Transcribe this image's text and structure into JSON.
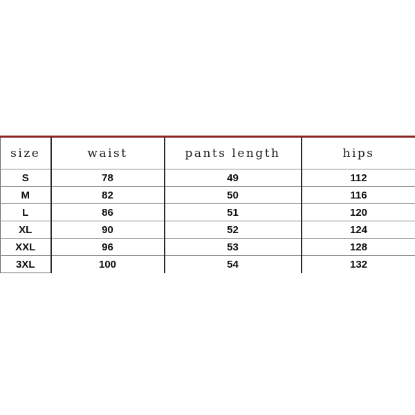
{
  "chart_data": {
    "type": "table",
    "title": "",
    "columns": [
      "size",
      "waist",
      "pants length",
      "hips"
    ],
    "rows": [
      [
        "S",
        "78",
        "49",
        "112"
      ],
      [
        "M",
        "82",
        "50",
        "116"
      ],
      [
        "L",
        "86",
        "51",
        "120"
      ],
      [
        "XL",
        "90",
        "52",
        "124"
      ],
      [
        "XXL",
        "96",
        "53",
        "128"
      ],
      [
        "3XL",
        "100",
        "54",
        "132"
      ]
    ],
    "units": "",
    "legend": "",
    "grid": true
  },
  "table": {
    "headers": {
      "size": "size",
      "waist": "waist",
      "pants_length": "pants length",
      "hips": "hips"
    },
    "rows": [
      {
        "size": "S",
        "waist": "78",
        "pants_length": "49",
        "hips": "112"
      },
      {
        "size": "M",
        "waist": "82",
        "pants_length": "50",
        "hips": "116"
      },
      {
        "size": "L",
        "waist": "86",
        "pants_length": "51",
        "hips": "120"
      },
      {
        "size": "XL",
        "waist": "90",
        "pants_length": "52",
        "hips": "124"
      },
      {
        "size": "XXL",
        "waist": "96",
        "pants_length": "53",
        "hips": "128"
      },
      {
        "size": "3XL",
        "waist": "100",
        "pants_length": "54",
        "hips": "132"
      }
    ]
  },
  "colors": {
    "page_background": "#ffffff",
    "top_rule": "#8b2525",
    "column_divider": "#2b2b2b",
    "row_divider": "#8a8a8a",
    "text": "#0d0d0d"
  }
}
